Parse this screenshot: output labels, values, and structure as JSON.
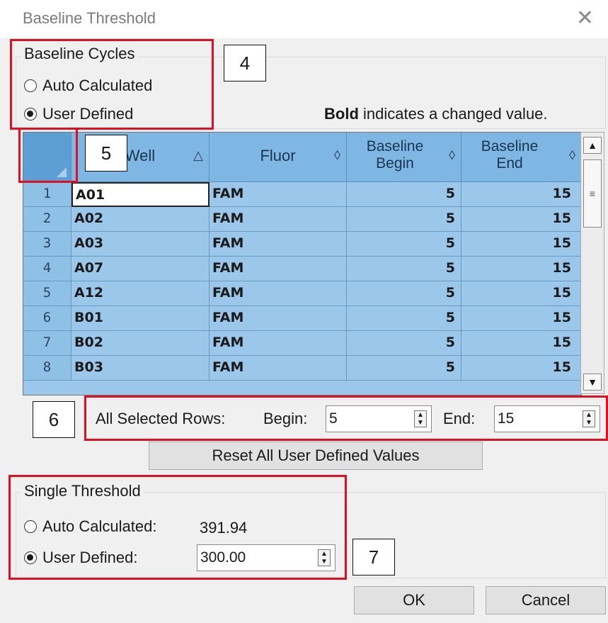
{
  "window": {
    "title": "Baseline Threshold",
    "close_icon": "close-icon"
  },
  "baseline_cycles": {
    "legend": "Baseline Cycles",
    "auto_label": "Auto Calculated",
    "user_label": "User Defined",
    "selected": "User Defined"
  },
  "hint": {
    "bold": "Bold",
    "rest": " indicates a changed value."
  },
  "grid": {
    "columns": [
      {
        "label": "Well",
        "sort": "△"
      },
      {
        "label": "Fluor",
        "sort": "◊"
      },
      {
        "label": "Baseline Begin",
        "sort": "◊"
      },
      {
        "label": "Baseline End",
        "sort": "◊"
      }
    ],
    "rows": [
      {
        "num": "1",
        "well": "A01",
        "fluor": "FAM",
        "begin": "5",
        "end": "15"
      },
      {
        "num": "2",
        "well": "A02",
        "fluor": "FAM",
        "begin": "5",
        "end": "15"
      },
      {
        "num": "3",
        "well": "A03",
        "fluor": "FAM",
        "begin": "5",
        "end": "15"
      },
      {
        "num": "4",
        "well": "A07",
        "fluor": "FAM",
        "begin": "5",
        "end": "15"
      },
      {
        "num": "5",
        "well": "A12",
        "fluor": "FAM",
        "begin": "5",
        "end": "15"
      },
      {
        "num": "6",
        "well": "B01",
        "fluor": "FAM",
        "begin": "5",
        "end": "15"
      },
      {
        "num": "7",
        "well": "B02",
        "fluor": "FAM",
        "begin": "5",
        "end": "15"
      },
      {
        "num": "8",
        "well": "B03",
        "fluor": "FAM",
        "begin": "5",
        "end": "15"
      }
    ]
  },
  "selected_rows": {
    "label": "All Selected Rows:",
    "begin_label": "Begin:",
    "begin_value": "5",
    "end_label": "End:",
    "end_value": "15"
  },
  "reset_button": "Reset All User Defined Values",
  "single_threshold": {
    "legend": "Single Threshold",
    "auto_label": "Auto Calculated:",
    "auto_value": "391.94",
    "user_label": "User Defined:",
    "user_value": "300.00",
    "selected": "User Defined"
  },
  "buttons": {
    "ok": "OK",
    "cancel": "Cancel"
  },
  "callouts": {
    "c4": "4",
    "c5": "5",
    "c6": "6",
    "c7": "7"
  },
  "colors": {
    "annotation_red": "#e01020",
    "grid_blue": "#9bc7ea",
    "header_blue": "#7eb7e3"
  }
}
